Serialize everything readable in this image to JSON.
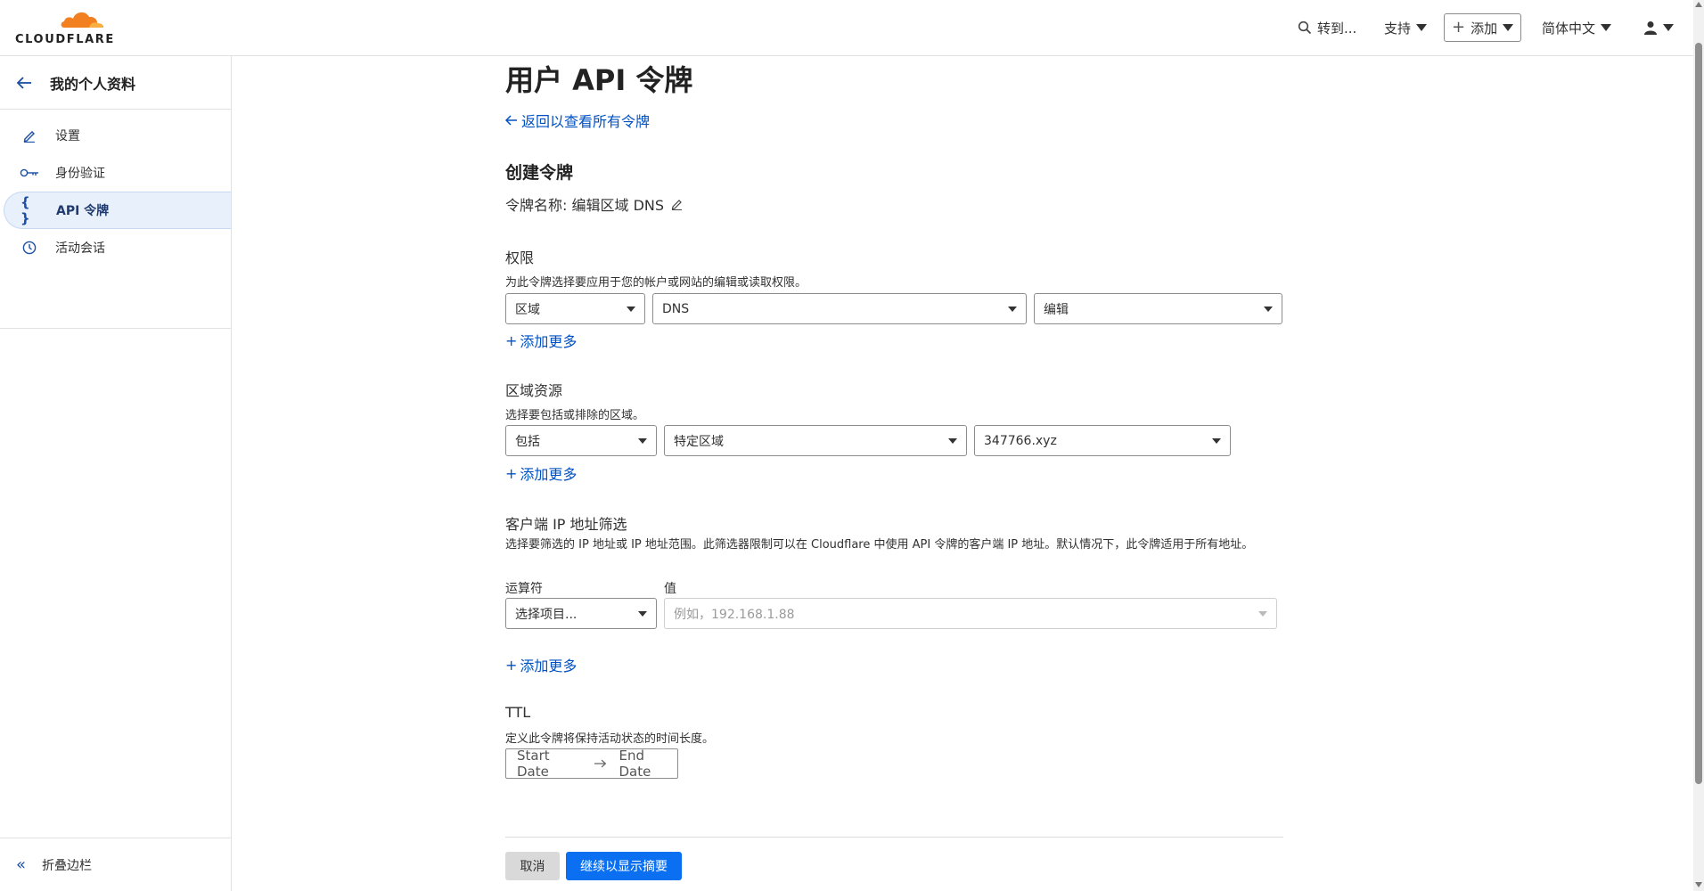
{
  "header": {
    "logo_text": "CLOUDFLARE",
    "search_label": "转到...",
    "support_label": "支持",
    "add_label": "添加",
    "language_label": "简体中文",
    "accent_color": "#f38020"
  },
  "sidebar": {
    "title": "我的个人资料",
    "items": [
      {
        "label": "设置",
        "icon": "pencil-icon"
      },
      {
        "label": "身份验证",
        "icon": "key-icon"
      },
      {
        "label": "API 令牌",
        "icon": "braces-icon",
        "active": true
      },
      {
        "label": "活动会话",
        "icon": "clock-icon"
      }
    ],
    "collapse_label": "折叠边栏"
  },
  "main": {
    "page_title": "用户 API 令牌",
    "back_link": "返回以查看所有令牌",
    "section_title": "创建令牌",
    "token_name": "令牌名称: 编辑区域 DNS",
    "permissions": {
      "title": "权限",
      "description": "为此令牌选择要应用于您的帐户或网站的编辑或读取权限。",
      "scope": "区域",
      "resource": "DNS",
      "level": "编辑",
      "add_more": "添加更多"
    },
    "zone_resources": {
      "title": "区域资源",
      "description": "选择要包括或排除的区域。",
      "mode": "包括",
      "target": "特定区域",
      "zone": "347766.xyz",
      "add_more": "添加更多"
    },
    "ip_filter": {
      "title": "客户端 IP 地址筛选",
      "description": "选择要筛选的 IP 地址或 IP 地址范围。此筛选器限制可以在 Cloudflare 中使用 API 令牌的客户端 IP 地址。默认情况下，此令牌适用于所有地址。",
      "operator_label": "运算符",
      "value_label": "值",
      "operator_value": "选择项目...",
      "value_placeholder": "例如，192.168.1.88",
      "add_more": "添加更多"
    },
    "ttl": {
      "title": "TTL",
      "description": "定义此令牌将保持活动状态的时间长度。",
      "start_date": "Start Date",
      "end_date": "End Date"
    },
    "buttons": {
      "cancel": "取消",
      "continue": "继续以显示摘要"
    }
  }
}
